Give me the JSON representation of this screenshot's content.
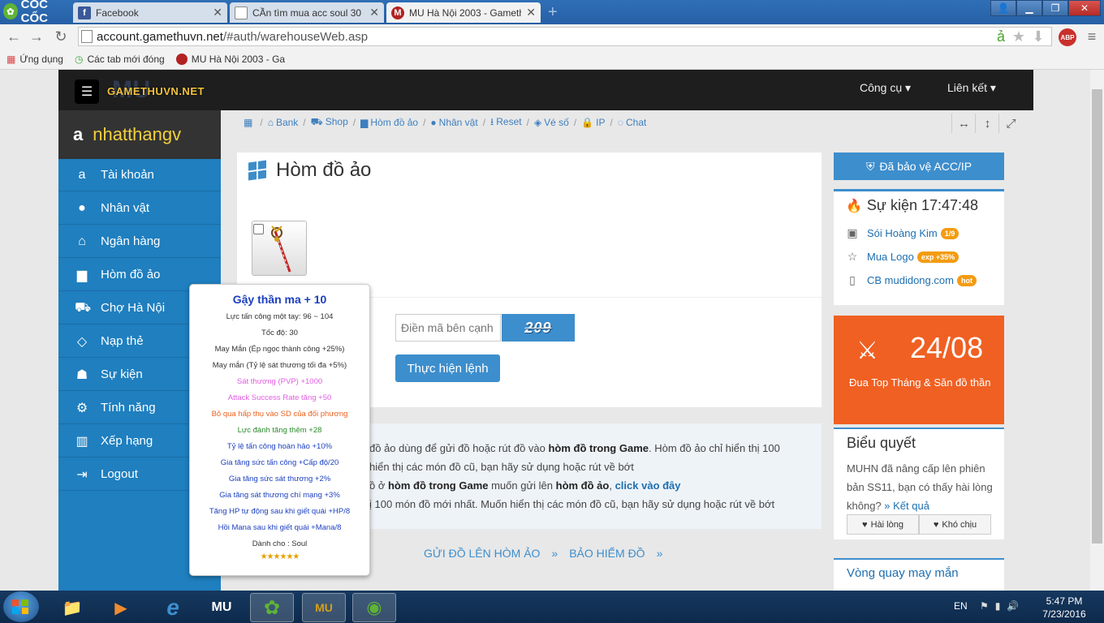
{
  "browser": {
    "brand": "CỐC CỐC",
    "tabs": [
      {
        "label": "Facebook",
        "icon": "facebook-icon",
        "color": "#3b5998"
      },
      {
        "label": "CẦn tìm mua acc soul 30 c",
        "icon": "page-icon",
        "color": "#888888"
      },
      {
        "label": "MU Hà Nội 2003 - Gameth",
        "icon": "mu-icon",
        "color": "#b22222"
      }
    ],
    "url_domain": "account.gamethuvn.net",
    "url_path": "/#auth/warehouseWeb.asp",
    "bookmarks": [
      {
        "label": "Ứng dụng"
      },
      {
        "label": "Các tab mới đóng"
      },
      {
        "label": "MU Hà Nội 2003 - Ga"
      }
    ]
  },
  "site": {
    "brand": "GAMETHUVN.NET",
    "brand_logo": "MU",
    "topmenu": [
      "Công cụ ▾",
      "Liên kết ▾"
    ],
    "username": "nhatthangv",
    "sidebar": [
      {
        "label": "Tài khoản",
        "icon": "amazon-icon",
        "glyph": "a"
      },
      {
        "label": "Nhân vật",
        "icon": "user-icon",
        "glyph": "●"
      },
      {
        "label": "Ngân hàng",
        "icon": "bank-icon",
        "glyph": "⌂"
      },
      {
        "label": "Hòm đồ ảo",
        "icon": "briefcase-icon",
        "glyph": "▆"
      },
      {
        "label": "Chợ Hà Nội",
        "icon": "cart-icon",
        "glyph": "⛟"
      },
      {
        "label": "Nạp thẻ",
        "icon": "diamond-icon",
        "glyph": "◇"
      },
      {
        "label": "Sự kiện",
        "icon": "android-icon",
        "glyph": "☗"
      },
      {
        "label": "Tính năng",
        "icon": "cogs-icon",
        "glyph": "⚙"
      },
      {
        "label": "Xếp hạng",
        "icon": "bar-chart-icon",
        "glyph": "▥"
      },
      {
        "label": "Logout",
        "icon": "logout-icon",
        "glyph": "⇥"
      }
    ],
    "breadcrumbs": [
      {
        "label": "",
        "icon": "calendar-icon",
        "glyph": "▦"
      },
      {
        "label": "Bank",
        "icon": "bank-icon",
        "glyph": "⌂"
      },
      {
        "label": "Shop",
        "icon": "cart-icon",
        "glyph": "⛟"
      },
      {
        "label": "Hòm đồ ảo",
        "icon": "briefcase-icon",
        "glyph": "▆"
      },
      {
        "label": "Nhân vật",
        "icon": "user-icon",
        "glyph": "●"
      },
      {
        "label": "Reset",
        "icon": "reset-icon",
        "glyph": "⭳"
      },
      {
        "label": "Vé số",
        "icon": "ticket-icon",
        "glyph": "◈"
      },
      {
        "label": "IP",
        "icon": "lock-icon",
        "glyph": "🔒"
      },
      {
        "label": "Chat",
        "icon": "chat-icon",
        "glyph": "◌"
      }
    ]
  },
  "main": {
    "title": "Hòm đồ ảo",
    "captcha_label": "t",
    "captcha_placeholder": "Điền mã bên cạnh",
    "captcha_code": "209",
    "submit_label": "Thực hiện lệnh",
    "info": {
      "line1_a": "đồ ảo dùng để gửi đồ hoặc rút đồ vào ",
      "line1_b": "hòm đồ trong Game",
      "line1_c": ". Hòm đồ ảo chỉ hiển thị 100",
      "line2": "hiển thị các món đồ cũ, bạn hãy sử dụng hoặc rút về bớt",
      "line3_a": "ồ ở ",
      "line3_b": "hòm đồ trong Game",
      "line3_c": " muốn gửi lên ",
      "line3_d": "hòm đồ ảo",
      "line3_e": ", ",
      "line3_link": "click vào đây",
      "line4": "ị 100 món đồ mới nhất. Muốn hiển thị các món đồ cũ, bạn hãy sử dụng hoặc rút về bớt"
    },
    "actions": [
      "GỬI ĐỒ LÊN HÒM ẢO",
      "»",
      "BẢO HIỂM ĐỒ",
      "»"
    ]
  },
  "tooltip": {
    "title": "Gậy thần ma + 10",
    "lines": [
      {
        "text": "Lực tấn công một tay: 96 ~ 104",
        "color": "#333333"
      },
      {
        "text": "Tốc độ: 30",
        "color": "#333333"
      },
      {
        "text": "May Mắn (Ép ngọc thành công +25%)",
        "color": "#333333"
      },
      {
        "text": "May mắn (Tỷ lệ sát thương tối đa +5%)",
        "color": "#333333"
      },
      {
        "text": "Sát thương (PVP) +1000",
        "color": "#e05ee0"
      },
      {
        "text": "Attack Success Rate tăng +50",
        "color": "#e05ee0"
      },
      {
        "text": "Bỏ qua hấp thụ vào SD của đối phương",
        "color": "#e8621f"
      },
      {
        "text": "Lực đánh tăng thêm +28",
        "color": "#2a8a2a"
      },
      {
        "text": "Tỷ lệ tấn công hoàn hảo +10%",
        "color": "#1b3fbf"
      },
      {
        "text": "Gia tăng sức tấn công +Cấp độ/20",
        "color": "#1b3fbf"
      },
      {
        "text": "Gia tăng sức sát thương +2%",
        "color": "#1b3fbf"
      },
      {
        "text": "Gia tăng sát thương chí mạng +3%",
        "color": "#1b3fbf"
      },
      {
        "text": "Tăng HP tự động sau khi giết quái +HP/8",
        "color": "#1b3fbf"
      },
      {
        "text": "Hồi Mana sau khi giết quái +Mana/8",
        "color": "#1b3fbf"
      },
      {
        "text": "Dành cho : Soul",
        "color": "#333333"
      }
    ],
    "stars": "★★★★★★"
  },
  "right": {
    "protect_label": "Đã bảo vệ ACC/IP",
    "event_title": "Sự kiện 17:47:48",
    "events": [
      {
        "label": "Sói Hoàng Kim",
        "badge": "1/9",
        "icon": "gift-icon",
        "glyph": "▣"
      },
      {
        "label": "Mua Logo",
        "badge": "exp +35%",
        "icon": "star-icon",
        "glyph": "☆"
      },
      {
        "label": "CB mudidong.com",
        "badge": "hot",
        "icon": "mobile-icon",
        "glyph": "▯"
      }
    ],
    "date": "24/08",
    "date_text": "Đua Top Tháng & Săn đồ thần",
    "poll_title": "Biểu quyết",
    "poll_text": "MUHN đã nâng cấp lên phiên bản SS11, bạn có thấy hài lòng không?",
    "poll_link": "» Kết quả",
    "poll_yes": "Hài lòng",
    "poll_no": "Khó chịu",
    "wheel_title": "Vòng quay may mắn"
  },
  "taskbar": {
    "lang": "EN",
    "time": "5:47 PM",
    "date": "7/23/2016"
  }
}
